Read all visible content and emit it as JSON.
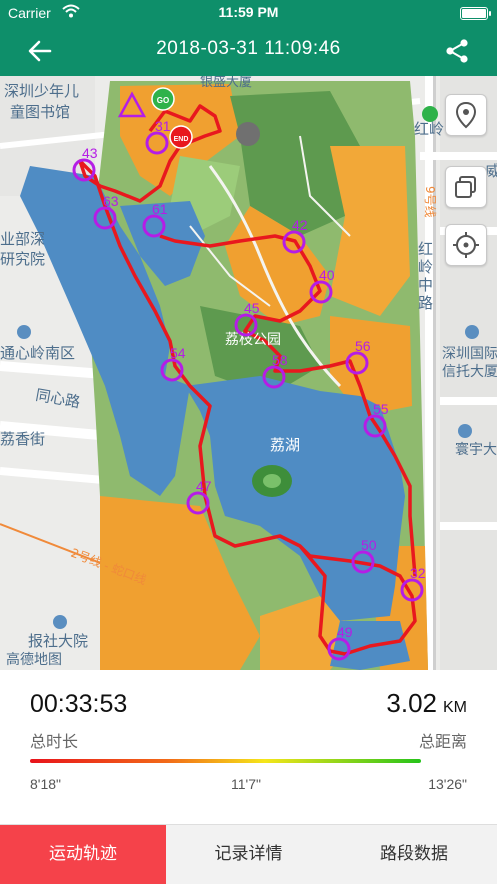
{
  "status_bar": {
    "carrier": "Carrier",
    "time": "11:59 PM"
  },
  "nav": {
    "title": "2018-03-31   11:09:46"
  },
  "map": {
    "poi": {
      "library_line1": "深圳少年儿",
      "library_line2": "童图书馆",
      "building_top": "银盛大厦",
      "dept_line1": "业部深",
      "dept_line2": "研究院",
      "hongling": "红岭",
      "hongling_line1": "红",
      "hongling_line2": "岭",
      "hongling_line3": "中",
      "hongling_line4": "路",
      "wei": "威",
      "line9": "9号线",
      "xinling": "通心岭南区",
      "tongxin_road": "同心路",
      "lixiang": "荔香街",
      "park": "荔枝公园",
      "lake": "荔湖",
      "trust_line1": "深圳国际",
      "trust_line2": "信托大厦",
      "huanyu": "寰宇大",
      "line2": "2号线 - 蛇口线",
      "baoshe": "报社大院",
      "gaode": "高德地图"
    },
    "markers": [
      "43",
      "31",
      "63",
      "61",
      "42",
      "40",
      "45",
      "54",
      "58",
      "56",
      "55",
      "47",
      "50",
      "32",
      "49"
    ],
    "start_label": "GO",
    "end_label": "END",
    "route_color": "#e8181e",
    "marker_color": "#b51de6"
  },
  "stats": {
    "duration": "00:33:53",
    "duration_label": "总时长",
    "distance": "3.02",
    "distance_unit": "KM",
    "distance_label": "总距离",
    "pace_min": "8'18\"",
    "pace_mid": "11'7\"",
    "pace_max": "13'26\""
  },
  "tabs": [
    {
      "label": "运动轨迹",
      "active": true
    },
    {
      "label": "记录详情",
      "active": false
    },
    {
      "label": "路段数据",
      "active": false
    }
  ]
}
